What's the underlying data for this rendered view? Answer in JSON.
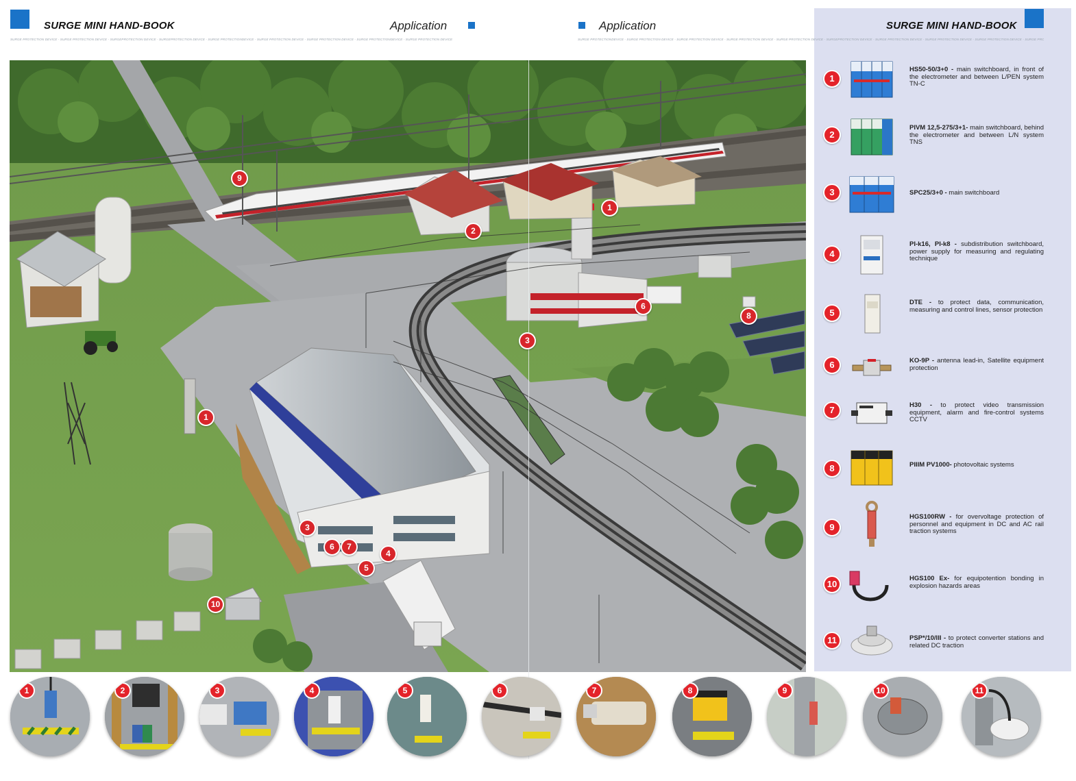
{
  "header": {
    "left_title": "SURGE MINI HAND-BOOK",
    "left_section": "Application",
    "right_section": "Application",
    "right_title": "SURGE MINI HAND-BOOK",
    "micro_left": "SURGE PROTECTION DEVICE - SURGE PROTECTION DEVICE - SURGEPROTECTION DEVICE - SURGEPROTECTION DEVICE - SURGE PROTECTIONDEVICE - SURGE PROTECTION DEVICE - SURGE PROTECTION DEVICE - SURGE PROTECTIONDEVICE - SURGE PROTECTION DEVICE",
    "micro_right": "SURGE PROTECTIONDEVICE - SURGE PROTECTION DEVICE - SURGE PROTECTION DEVICE - SURGE PROTECTION DEVICE - SURGE PROTECTION DEVICE - SURGEPROTECTION DEVICE - SURGE PROTECTION DEVICE - SURGE PROTECTION DEVICE - SURGE PROTECTION DEVICE - SURGE PROTECTION DEVICE"
  },
  "scene_badges": [
    "9",
    "2",
    "1",
    "6",
    "8",
    "3",
    "1",
    "3",
    "6",
    "7",
    "4",
    "5",
    "10"
  ],
  "products": [
    {
      "num": "1",
      "name": "HS50-50/3+0 -",
      "desc": " main switchboard, in front of the electrometer and between L/PEN system TN-C"
    },
    {
      "num": "2",
      "name": "PIVM 12,5-275/3+1-",
      "desc": " main switchboard, behind the electrometer and between L/N system TNS"
    },
    {
      "num": "3",
      "name": "SPC25/3+0 -",
      "desc": " main switchboard"
    },
    {
      "num": "4",
      "name": "PI-k16, PI-k8 -",
      "desc": " subdistribution switchboard, power supply for measuring and regulating technique"
    },
    {
      "num": "5",
      "name": "DTE -",
      "desc": " to protect data, communication, measuring and control lines, sensor protection"
    },
    {
      "num": "6",
      "name": "KO-9P -",
      "desc": " antenna lead-in, Satellite equipment protection"
    },
    {
      "num": "7",
      "name": "H30 -",
      "desc": " to protect video transmission equipment, alarm and fire-control systems CCTV"
    },
    {
      "num": "8",
      "name": "PIIIM PV1000-",
      "desc": " photovoltaic systems"
    },
    {
      "num": "9",
      "name": "HGS100RW -",
      "desc": " for overvoltage protection of personnel and equipment in DC and AC rail traction systems"
    },
    {
      "num": "10",
      "name": "HGS100 Ex-",
      "desc": " for equipotention bonding in explosion hazards areas"
    },
    {
      "num": "11",
      "name": "PSP*/10/III -",
      "desc": " to protect converter stations and related DC traction"
    }
  ],
  "circles": [
    "1",
    "2",
    "3",
    "4",
    "5",
    "6",
    "7",
    "8",
    "9",
    "10",
    "11"
  ],
  "icons": {
    "header_square": "blue-square-icon",
    "badge": "red-number-badge"
  },
  "colors": {
    "accent_blue": "#1a73c8",
    "badge_red": "#e4232a",
    "panel_bg": "#dcdff0"
  }
}
